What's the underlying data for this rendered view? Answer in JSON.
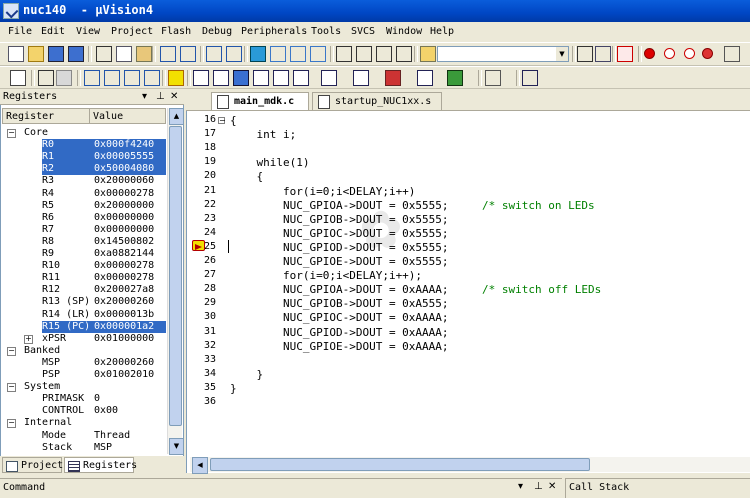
{
  "window": {
    "title": "nuc140  - µVision4"
  },
  "menu": [
    "File",
    "Edit",
    "View",
    "Project",
    "Flash",
    "Debug",
    "Peripherals",
    "Tools",
    "SVCS",
    "Window",
    "Help"
  ],
  "registers_panel": {
    "title": "Registers",
    "columns": [
      "Register",
      "Value"
    ],
    "rows": [
      {
        "indent": 0,
        "expander": "-",
        "name": "Core",
        "value": "",
        "selected": false
      },
      {
        "indent": 2,
        "expander": "",
        "name": "R0",
        "value": "0x000f4240",
        "selected": true
      },
      {
        "indent": 2,
        "expander": "",
        "name": "R1",
        "value": "0x00005555",
        "selected": true
      },
      {
        "indent": 2,
        "expander": "",
        "name": "R2",
        "value": "0x50004080",
        "selected": true
      },
      {
        "indent": 2,
        "expander": "",
        "name": "R3",
        "value": "0x20000060",
        "selected": false
      },
      {
        "indent": 2,
        "expander": "",
        "name": "R4",
        "value": "0x00000278",
        "selected": false
      },
      {
        "indent": 2,
        "expander": "",
        "name": "R5",
        "value": "0x20000000",
        "selected": false
      },
      {
        "indent": 2,
        "expander": "",
        "name": "R6",
        "value": "0x00000000",
        "selected": false
      },
      {
        "indent": 2,
        "expander": "",
        "name": "R7",
        "value": "0x00000000",
        "selected": false
      },
      {
        "indent": 2,
        "expander": "",
        "name": "R8",
        "value": "0x14500802",
        "selected": false
      },
      {
        "indent": 2,
        "expander": "",
        "name": "R9",
        "value": "0xa0882144",
        "selected": false
      },
      {
        "indent": 2,
        "expander": "",
        "name": "R10",
        "value": "0x00000278",
        "selected": false
      },
      {
        "indent": 2,
        "expander": "",
        "name": "R11",
        "value": "0x00000278",
        "selected": false
      },
      {
        "indent": 2,
        "expander": "",
        "name": "R12",
        "value": "0x200027a8",
        "selected": false
      },
      {
        "indent": 2,
        "expander": "",
        "name": "R13 (SP)",
        "value": "0x20000260",
        "selected": false
      },
      {
        "indent": 2,
        "expander": "",
        "name": "R14 (LR)",
        "value": "0x0000013b",
        "selected": false
      },
      {
        "indent": 2,
        "expander": "",
        "name": "R15 (PC)",
        "value": "0x000001a2",
        "selected": true
      },
      {
        "indent": 2,
        "expander": "+",
        "name": "xPSR",
        "value": "0x01000000",
        "selected": false
      },
      {
        "indent": 0,
        "expander": "-",
        "name": "Banked",
        "value": "",
        "selected": false
      },
      {
        "indent": 2,
        "expander": "",
        "name": "MSP",
        "value": "0x20000260",
        "selected": false
      },
      {
        "indent": 2,
        "expander": "",
        "name": "PSP",
        "value": "0x01002010",
        "selected": false
      },
      {
        "indent": 0,
        "expander": "-",
        "name": "System",
        "value": "",
        "selected": false
      },
      {
        "indent": 2,
        "expander": "",
        "name": "PRIMASK",
        "value": "0",
        "selected": false
      },
      {
        "indent": 2,
        "expander": "",
        "name": "CONTROL",
        "value": "0x00",
        "selected": false
      },
      {
        "indent": 0,
        "expander": "-",
        "name": "Internal",
        "value": "",
        "selected": false
      },
      {
        "indent": 2,
        "expander": "",
        "name": "Mode",
        "value": "Thread",
        "selected": false
      },
      {
        "indent": 2,
        "expander": "",
        "name": "Stack",
        "value": "MSP",
        "selected": false
      }
    ],
    "tabs": [
      "Project",
      "Registers"
    ]
  },
  "editor": {
    "tabs": [
      "main_mdk.c",
      "startup_NUC1xx.s"
    ],
    "current_line": "25",
    "lines": [
      {
        "n": "16",
        "text": "{",
        "collapse": true
      },
      {
        "n": "17",
        "text": "    int i;"
      },
      {
        "n": "18",
        "text": ""
      },
      {
        "n": "19",
        "text": "    while(1)"
      },
      {
        "n": "20",
        "text": "    {"
      },
      {
        "n": "21",
        "text": "        for(i=0;i<DELAY;i++)"
      },
      {
        "n": "22",
        "text": "        NUC_GPIOA->DOUT = 0x5555;",
        "comment": "/* switch on LEDs"
      },
      {
        "n": "23",
        "text": "        NUC_GPIOB->DOUT = 0x5555;"
      },
      {
        "n": "24",
        "text": "        NUC_GPIOC->DOUT = 0x5555;"
      },
      {
        "n": "25",
        "text": "        NUC_GPIOD->DOUT = 0x5555;"
      },
      {
        "n": "26",
        "text": "        NUC_GPIOE->DOUT = 0x5555;"
      },
      {
        "n": "27",
        "text": "        for(i=0;i<DELAY;i++);"
      },
      {
        "n": "28",
        "text": "        NUC_GPIOA->DOUT = 0xAAAA;",
        "comment": "/* switch off LEDs"
      },
      {
        "n": "29",
        "text": "        NUC_GPIOB->DOUT = 0xA555;"
      },
      {
        "n": "30",
        "text": "        NUC_GPIOC->DOUT = 0xAAAA;"
      },
      {
        "n": "31",
        "text": "        NUC_GPIOD->DOUT = 0xAAAA;"
      },
      {
        "n": "32",
        "text": "        NUC_GPIOE->DOUT = 0xAAAA;"
      },
      {
        "n": "33",
        "text": ""
      },
      {
        "n": "34",
        "text": "    }"
      },
      {
        "n": "35",
        "text": "}"
      },
      {
        "n": "36",
        "text": ""
      }
    ]
  },
  "bottom": {
    "command_title": "Command",
    "callstack_title": "Call Stack"
  },
  "colors": {
    "selection": "#316ac5",
    "titlebar": "#0a5ddb",
    "comment": "#008000"
  }
}
